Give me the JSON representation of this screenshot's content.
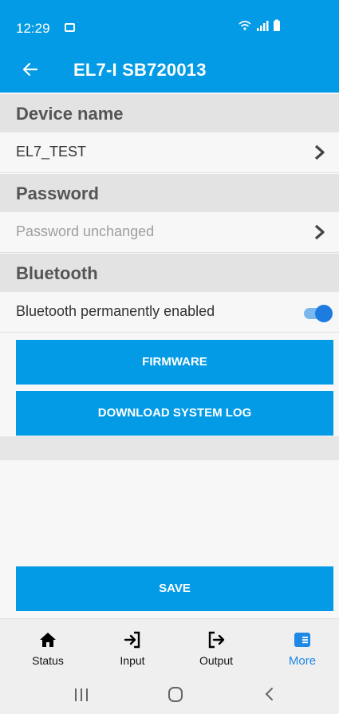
{
  "status_bar": {
    "time": "12:29",
    "icons": "WiFi ▂▄▆ ▮"
  },
  "app_bar": {
    "back_icon": "arrow-left-icon",
    "title": "EL7-I SB720013"
  },
  "sections": {
    "device_name": {
      "heading": "Device name",
      "value": "EL7_TEST"
    },
    "password": {
      "heading": "Password",
      "value": "Password unchanged"
    },
    "bluetooth": {
      "heading": "Bluetooth",
      "label": "Bluetooth permanently enabled",
      "enabled": true
    }
  },
  "buttons": {
    "firmware": "FIRMWARE",
    "download_log": "DOWNLOAD SYSTEM LOG",
    "save": "SAVE"
  },
  "tabs": [
    {
      "label": "Status",
      "icon": "home-icon",
      "active": false
    },
    {
      "label": "Input",
      "icon": "login-icon",
      "active": false
    },
    {
      "label": "Output",
      "icon": "logout-icon",
      "active": false
    },
    {
      "label": "More",
      "icon": "list-box-icon",
      "active": true
    }
  ],
  "system_nav": {
    "recents": "recents-icon",
    "home": "home-circle-icon",
    "back": "back-chevron-icon"
  },
  "colors": {
    "primary": "#039be5",
    "active_tab": "#1e88e5",
    "toggle_knob": "#1e7be0"
  }
}
